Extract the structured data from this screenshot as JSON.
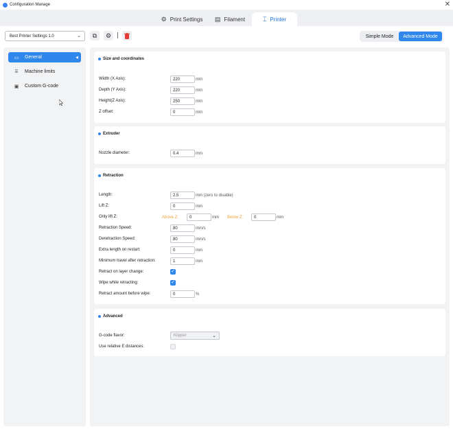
{
  "window": {
    "title": "Configuration Manage",
    "close_glyph": "✕"
  },
  "tabs": [
    {
      "label": "Print Settings",
      "icon": "gear-icon"
    },
    {
      "label": "Filament",
      "icon": "filament-icon"
    },
    {
      "label": "Printer",
      "icon": "printer-icon"
    }
  ],
  "toolbar": {
    "preset_value": "Best Printer Settings 1.0",
    "simple_mode_label": "Simple Mode",
    "advanced_mode_label": "Advanced Mode"
  },
  "sidebar": {
    "items": [
      {
        "label": "General",
        "icon": "general-icon"
      },
      {
        "label": "Machine limits",
        "icon": "machine-limits-icon"
      },
      {
        "label": "Custom G-code",
        "icon": "gcode-icon"
      }
    ]
  },
  "size": {
    "title": "Size and coordinates",
    "width_label": "Width (X Axis):",
    "width_value": "220",
    "width_unit": "mm",
    "depth_label": "Depth (Y Axis):",
    "depth_value": "220",
    "depth_unit": "mm",
    "height_label": "Height(Z Axis):",
    "height_value": "250",
    "height_unit": "mm",
    "zoffset_label": "Z offset:",
    "zoffset_value": "0",
    "zoffset_unit": "mm"
  },
  "extruder": {
    "title": "Extruder",
    "nozzle_label": "Nozzle diameter:",
    "nozzle_value": "0.4",
    "nozzle_unit": "mm"
  },
  "retraction": {
    "title": "Retraction",
    "length_label": "Length:",
    "length_value": "2.5",
    "length_unit": "mm (zero to disable)",
    "liftz_label": "Lift Z:",
    "liftz_value": "0",
    "liftz_unit": "mm",
    "onlylift_label": "Only lift Z:",
    "above_label": "Above Z:",
    "above_value": "0",
    "above_unit": "mm",
    "below_label": "Below Z:",
    "below_value": "0",
    "below_unit": "mm",
    "retspeed_label": "Retraction Speed:",
    "retspeed_value": "80",
    "retspeed_unit": "mm/s",
    "deretspeed_label": "Deretraction Speed:",
    "deretspeed_value": "80",
    "deretspeed_unit": "mm/s",
    "extralen_label": "Extra length on restart:",
    "extralen_value": "0",
    "extralen_unit": "mm",
    "mintravel_label": "Minimum travel after retraction:",
    "mintravel_value": "1",
    "mintravel_unit": "mm",
    "layerchange_label": "Retract on layer change:",
    "layerchange_checked": true,
    "wipe_label": "Wipe while retracting:",
    "wipe_checked": true,
    "beforewipe_label": "Retract amount before wipe:",
    "beforewipe_value": "0",
    "beforewipe_unit": "%"
  },
  "advanced": {
    "title": "Advanced",
    "flavor_label": "G-code flavor:",
    "flavor_value": "Klipper",
    "relative_e_label": "Use relative E distances:",
    "relative_e_checked": false
  },
  "colors": {
    "accent": "#2f86eb",
    "orange": "#e8a23b",
    "danger": "#e53935"
  }
}
